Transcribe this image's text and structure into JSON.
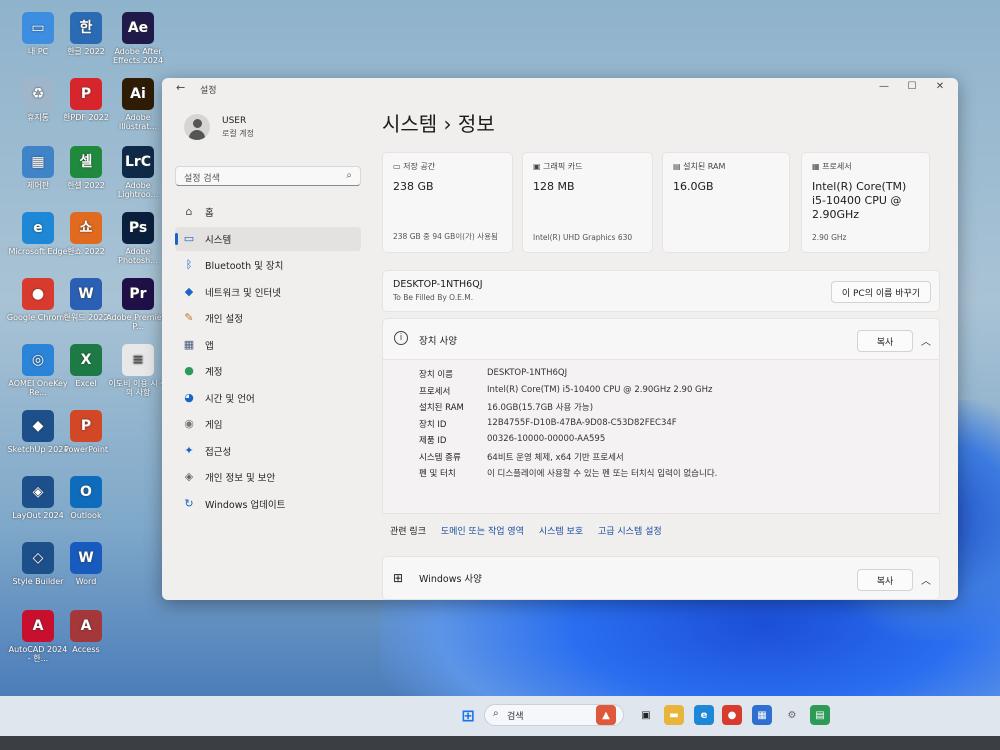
{
  "desktop": {
    "icons": [
      {
        "label": "내 PC",
        "glyph": "▭",
        "color": "#3d8ee0"
      },
      {
        "label": "휴지통",
        "glyph": "♻",
        "color": "#9fb5c9"
      },
      {
        "label": "제어판",
        "glyph": "▦",
        "color": "#3f84c9"
      },
      {
        "label": "Microsoft Edge",
        "glyph": "e",
        "color": "#1e88d6"
      },
      {
        "label": "Google Chrome",
        "glyph": "●",
        "color": "#d93a2e"
      },
      {
        "label": "AOMEI OneKey Re...",
        "glyph": "◎",
        "color": "#2c84d8"
      },
      {
        "label": "SketchUp 2024",
        "glyph": "◆",
        "color": "#1d4f8a"
      },
      {
        "label": "LayOut 2024",
        "glyph": "◈",
        "color": "#1d4f8a"
      },
      {
        "label": "Style Builder",
        "glyph": "◇",
        "color": "#1d4f8a"
      },
      {
        "label": "AutoCAD 2024 - 한...",
        "glyph": "A",
        "color": "#c8102e"
      },
      {
        "label": "한글 2022",
        "glyph": "한",
        "color": "#2a6bb3"
      },
      {
        "label": "한PDF 2022",
        "glyph": "P",
        "color": "#d7262b"
      },
      {
        "label": "한셀 2022",
        "glyph": "셀",
        "color": "#1f8a3d"
      },
      {
        "label": "한쇼 2022",
        "glyph": "쇼",
        "color": "#e06a1f"
      },
      {
        "label": "한워드 2022",
        "glyph": "W",
        "color": "#2b5fb3"
      },
      {
        "label": "Excel",
        "glyph": "X",
        "color": "#1e7a45"
      },
      {
        "label": "PowerPoint",
        "glyph": "P",
        "color": "#d24726"
      },
      {
        "label": "Outlook",
        "glyph": "O",
        "color": "#0f6cbd"
      },
      {
        "label": "Word",
        "glyph": "W",
        "color": "#185abd"
      },
      {
        "label": "Access",
        "glyph": "A",
        "color": "#a4373a"
      },
      {
        "label": "Adobe After Effects 2024",
        "glyph": "Ae",
        "color": "#1f1a4a"
      },
      {
        "label": "Adobe Illustrat...",
        "glyph": "Ai",
        "color": "#2f1c05"
      },
      {
        "label": "Adobe Lightroo...",
        "glyph": "LrC",
        "color": "#0f2a48"
      },
      {
        "label": "Adobe Photosh...",
        "glyph": "Ps",
        "color": "#0a1f3d"
      },
      {
        "label": "Adobe Premiere P...",
        "glyph": "Pr",
        "color": "#1f1048"
      },
      {
        "label": "이도비 이용 시 주의 사항",
        "glyph": "≡",
        "color": "#e8e8e8"
      }
    ]
  },
  "window": {
    "title": "설정",
    "back_glyph": "←",
    "controls": {
      "minimize": "—",
      "maximize": "☐",
      "close": "✕"
    }
  },
  "sidebar": {
    "user_name": "USER",
    "user_sub": "로컬 계정",
    "search_placeholder": "설정 검색",
    "search_icon": "⌕",
    "items": [
      {
        "label": "홈",
        "icon": "⌂",
        "color": "#555"
      },
      {
        "label": "시스템",
        "icon": "▭",
        "color": "#1a63c8"
      },
      {
        "label": "Bluetooth 및 장치",
        "icon": "ᛒ",
        "color": "#1a63c8"
      },
      {
        "label": "네트워크 및 인터넷",
        "icon": "◆",
        "color": "#1a63c8"
      },
      {
        "label": "개인 설정",
        "icon": "✎",
        "color": "#c07a2c"
      },
      {
        "label": "앱",
        "icon": "▦",
        "color": "#4a5c7a"
      },
      {
        "label": "계정",
        "icon": "●",
        "color": "#2e9a57"
      },
      {
        "label": "시간 및 언어",
        "icon": "◕",
        "color": "#1a63c8"
      },
      {
        "label": "게임",
        "icon": "◉",
        "color": "#777"
      },
      {
        "label": "접근성",
        "icon": "✦",
        "color": "#1a63c8"
      },
      {
        "label": "개인 정보 및 보안",
        "icon": "◈",
        "color": "#666"
      },
      {
        "label": "Windows 업데이트",
        "icon": "↻",
        "color": "#1a63c8"
      }
    ]
  },
  "main": {
    "title": "시스템  ›  정보",
    "cards": [
      {
        "label": "저장 공간",
        "value": "238 GB",
        "foot": "238 GB 중 94 GB이(가) 사용됨"
      },
      {
        "label": "그래픽 카드",
        "value": "128 MB",
        "foot": "Intel(R) UHD Graphics 630"
      },
      {
        "label": "설치된 RAM",
        "value": "16.0GB",
        "foot": ""
      },
      {
        "label": "프로세서",
        "value": "Intel(R) Core(TM) i5-10400 CPU @ 2.90GHz",
        "foot": "2.90 GHz"
      }
    ],
    "device_name": "DESKTOP-1NTH6QJ",
    "device_sub": "To Be Filled By O.E.M.",
    "rename_button": "이 PC의 이름 바꾸기",
    "device_specs": {
      "title": "장치 사양",
      "copy_button": "복사",
      "rows": [
        {
          "k": "장치 이름",
          "v": "DESKTOP-1NTH6QJ"
        },
        {
          "k": "프로세서",
          "v": "Intel(R) Core(TM) i5-10400 CPU @ 2.90GHz   2.90 GHz"
        },
        {
          "k": "설치된 RAM",
          "v": "16.0GB(15.7GB 사용 가능)"
        },
        {
          "k": "장치 ID",
          "v": "12B4755F-D10B-47BA-9D08-C53D82FEC34F"
        },
        {
          "k": "제품 ID",
          "v": "00326-10000-00000-AA595"
        },
        {
          "k": "시스템 종류",
          "v": "64비트 운영 체제, x64 기반 프로세서"
        },
        {
          "k": "펜 및 터치",
          "v": "이 디스플레이에 사용할 수 있는 펜 또는 터치식 입력이 없습니다."
        }
      ]
    },
    "related": {
      "label": "관련 링크",
      "links": [
        "도메인 또는 작업 영역",
        "시스템 보호",
        "고급 시스템 설정"
      ]
    },
    "windows_specs": {
      "title": "Windows 사양",
      "copy_button": "복사"
    }
  },
  "taskbar": {
    "search_label": "검색",
    "items": [
      {
        "name": "start",
        "glyph": "⊞",
        "color": "#1a73e8"
      },
      {
        "name": "widgets",
        "glyph": "▲",
        "color": "#e0583a"
      },
      {
        "name": "task-view",
        "glyph": "▣",
        "color": "#222"
      },
      {
        "name": "file-explorer",
        "glyph": "▬",
        "color": "#e8b53a"
      },
      {
        "name": "edge",
        "glyph": "e",
        "color": "#1e88d6"
      },
      {
        "name": "chrome",
        "glyph": "●",
        "color": "#d93a2e"
      },
      {
        "name": "store",
        "glyph": "▦",
        "color": "#2e6fd0"
      },
      {
        "name": "settings",
        "glyph": "⚙",
        "color": "#666"
      },
      {
        "name": "network",
        "glyph": "▤",
        "color": "#2e9a57"
      }
    ]
  }
}
